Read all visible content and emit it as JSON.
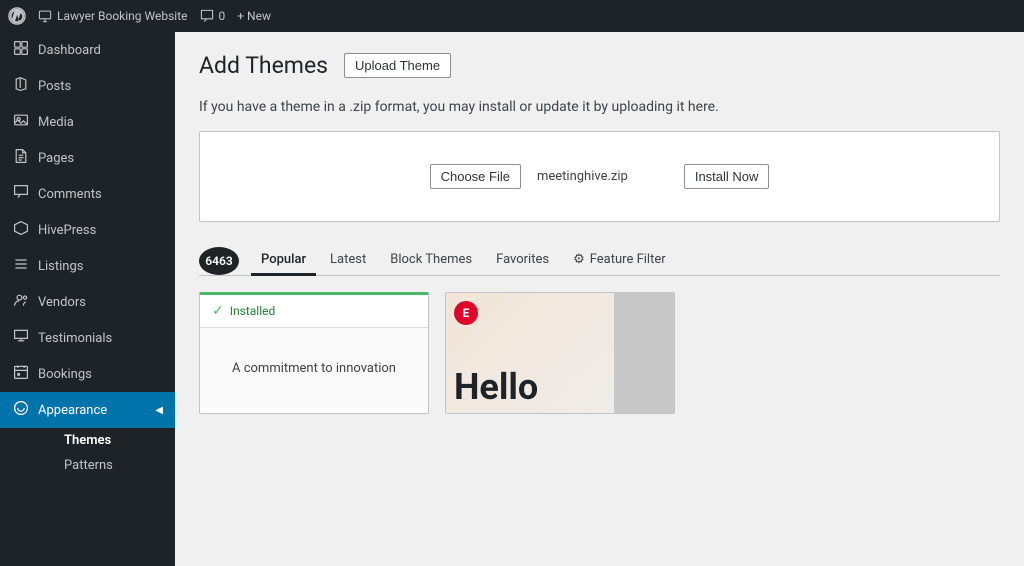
{
  "topbar": {
    "wp_logo": "⚲",
    "site_name": "Lawyer Booking Website",
    "comments_icon": "💬",
    "comments_count": "0",
    "new_label": "+ New"
  },
  "sidebar": {
    "items": [
      {
        "id": "dashboard",
        "icon": "⊞",
        "label": "Dashboard"
      },
      {
        "id": "posts",
        "icon": "📌",
        "label": "Posts"
      },
      {
        "id": "media",
        "icon": "🖼",
        "label": "Media"
      },
      {
        "id": "pages",
        "icon": "📄",
        "label": "Pages"
      },
      {
        "id": "comments",
        "icon": "💬",
        "label": "Comments"
      },
      {
        "id": "hivepress",
        "icon": "⬡",
        "label": "HivePress"
      },
      {
        "id": "listings",
        "icon": "☰",
        "label": "Listings"
      },
      {
        "id": "vendors",
        "icon": "👥",
        "label": "Vendors"
      },
      {
        "id": "testimonials",
        "icon": "💬",
        "label": "Testimonials"
      },
      {
        "id": "bookings",
        "icon": "📅",
        "label": "Bookings"
      },
      {
        "id": "appearance",
        "icon": "🎨",
        "label": "Appearance",
        "active": true
      }
    ],
    "sub_items": [
      {
        "id": "themes",
        "label": "Themes",
        "active": true
      },
      {
        "id": "patterns",
        "label": "Patterns"
      }
    ]
  },
  "page": {
    "title": "Add Themes",
    "upload_btn_label": "Upload Theme",
    "description": "If you have a theme in a .zip format, you may install or update it by uploading it here.",
    "choose_file_label": "Choose File",
    "file_name": "meetinghive.zip",
    "install_btn_label": "Install Now",
    "tabs": [
      {
        "id": "count",
        "label": "6463",
        "type": "count"
      },
      {
        "id": "popular",
        "label": "Popular",
        "active": true
      },
      {
        "id": "latest",
        "label": "Latest"
      },
      {
        "id": "block-themes",
        "label": "Block Themes"
      },
      {
        "id": "favorites",
        "label": "Favorites"
      },
      {
        "id": "feature-filter",
        "label": "Feature Filter",
        "icon": "⚙"
      }
    ],
    "theme_cards": [
      {
        "id": "card1",
        "installed": true,
        "installed_label": "Installed",
        "title": "A commitment to innovation"
      },
      {
        "id": "card2",
        "installed": false,
        "elementor_badge": "E",
        "hello_text": "Hello"
      }
    ]
  }
}
